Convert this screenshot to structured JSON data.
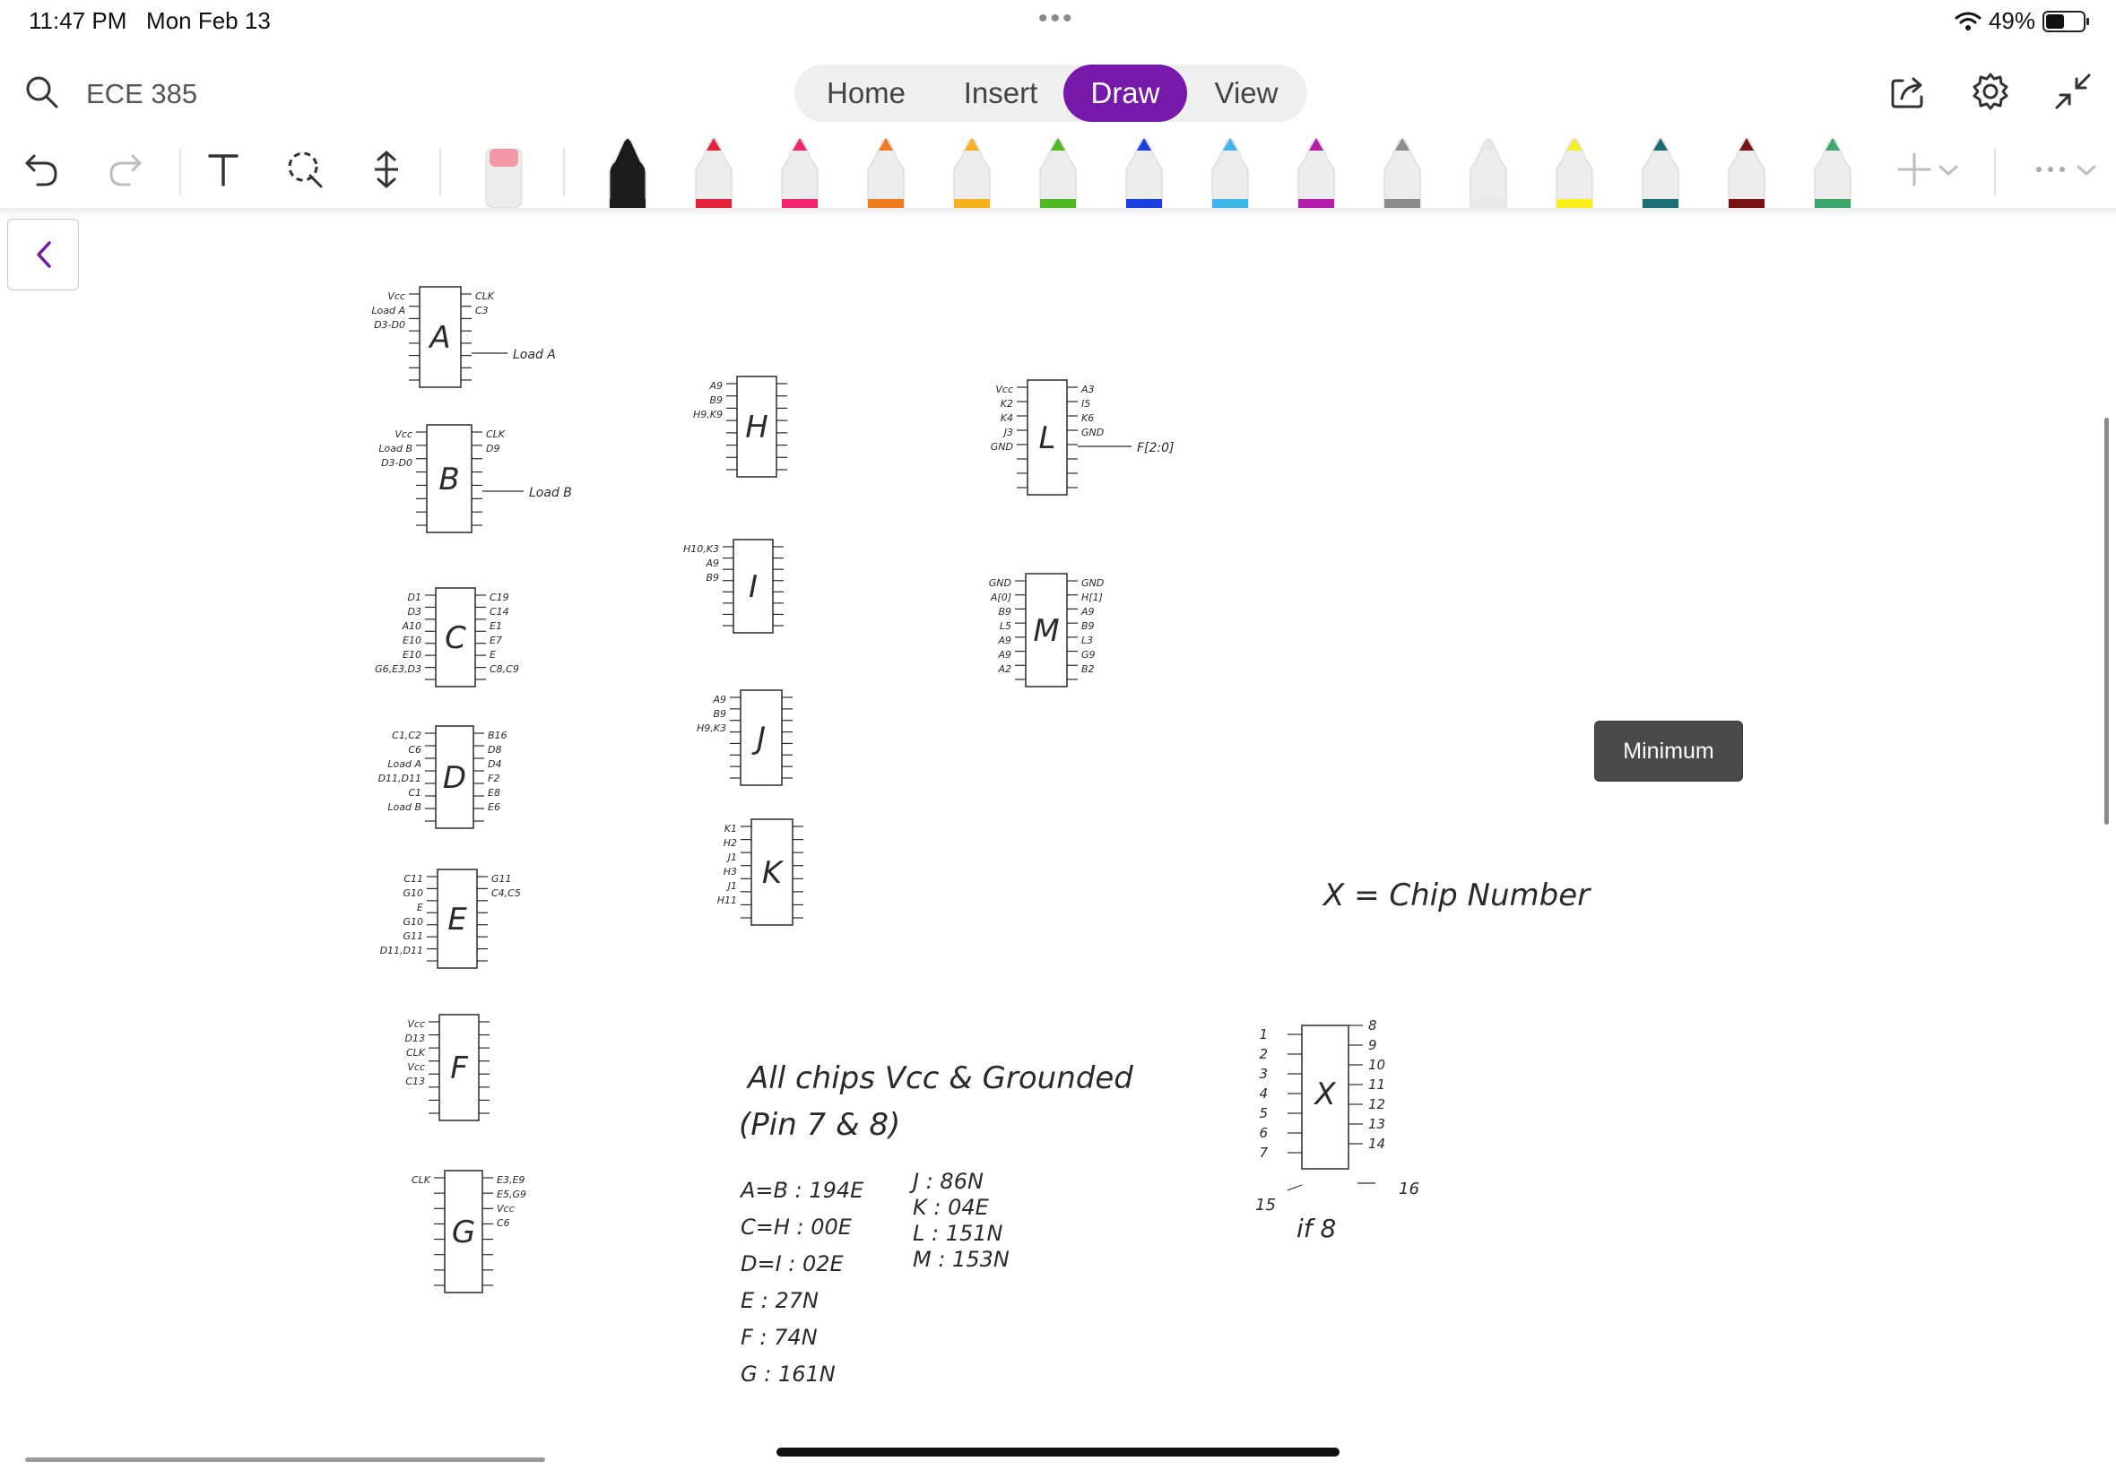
{
  "status_bar": {
    "time": "11:47 PM",
    "date": "Mon Feb 13",
    "dots": "•••",
    "battery": "49%",
    "battery_level": 0.49
  },
  "header": {
    "title": "ECE 385",
    "tabs": [
      {
        "label": "Home"
      },
      {
        "label": "Insert"
      },
      {
        "label": "Draw",
        "active": true
      },
      {
        "label": "View"
      }
    ],
    "accent": "#7719aa",
    "icons": [
      "search-icon",
      "share-icon",
      "settings-icon",
      "collapse-icon"
    ]
  },
  "toolbar": {
    "tools": [
      "undo-icon",
      "redo-icon",
      "text-icon",
      "lasso-icon",
      "add-space-icon",
      "eraser"
    ],
    "pens": [
      {
        "name": "black",
        "color": "#1c1c1c"
      },
      {
        "name": "red",
        "color": "#e2233a"
      },
      {
        "name": "pink",
        "color": "#f0256e"
      },
      {
        "name": "orange",
        "color": "#f07b1f"
      },
      {
        "name": "yellow-orange",
        "color": "#f5b21d"
      },
      {
        "name": "green",
        "color": "#4dbb1f"
      },
      {
        "name": "blue",
        "color": "#1a3fe0"
      },
      {
        "name": "light-blue",
        "color": "#3fb6ea"
      },
      {
        "name": "magenta",
        "color": "#b51ea8"
      },
      {
        "name": "gray",
        "color": "#8c8c8c"
      },
      {
        "name": "white",
        "color": "#e8e8e8"
      },
      {
        "name": "yellow-highlighter",
        "color": "#f8ef1c"
      },
      {
        "name": "teal-galaxy",
        "color": "#1b6f74"
      },
      {
        "name": "dark-red-galaxy",
        "color": "#7a1414"
      },
      {
        "name": "rainbow",
        "color": "#3aa76d"
      }
    ]
  },
  "tooltip": "Minimum",
  "notes": {
    "chip_labels": [
      "A",
      "B",
      "C",
      "D",
      "E",
      "F",
      "G",
      "H",
      "I",
      "J",
      "K",
      "L",
      "M"
    ],
    "pin_labels": {
      "A": {
        "left": [
          "Vcc",
          "Load A",
          "D3-D0"
        ],
        "right": [
          "CLK",
          "C3"
        ],
        "wire": "Load A"
      },
      "B": {
        "left": [
          "Vcc",
          "Load B",
          "D3-D0"
        ],
        "right": [
          "CLK",
          "D9"
        ],
        "wire": "Load B"
      },
      "C": {
        "left": [
          "D1",
          "D3",
          "A10",
          "E10",
          "E10",
          "G6,E3,D3"
        ],
        "right": [
          "C19",
          "C14",
          "E1",
          "E7",
          "E",
          "C8,C9"
        ]
      },
      "D": {
        "left": [
          "C1,C2",
          "C6",
          "Load A",
          "D11,D11",
          "C1",
          "Load B"
        ],
        "right": [
          "B16",
          "D8",
          "D4",
          "F2",
          "E8",
          "E6"
        ]
      },
      "E": {
        "left": [
          "C11",
          "G10",
          "E",
          "G10",
          "G11",
          "D11,D11"
        ],
        "right": [
          "G11",
          "C4,C5"
        ]
      },
      "F": {
        "left": [
          "Vcc",
          "D13",
          "CLK",
          "Vcc",
          "C13"
        ],
        "right": []
      },
      "G": {
        "left": [
          "CLK"
        ],
        "right": [
          "E3,E9",
          "E5,G9",
          "Vcc",
          "C6"
        ]
      },
      "H": {
        "left": [
          "A9",
          "B9",
          "H9,K9"
        ],
        "right": []
      },
      "I": {
        "left": [
          "H10,K3",
          "A9",
          "B9"
        ],
        "right": []
      },
      "J": {
        "left": [
          "A9",
          "B9",
          "H9,K3"
        ],
        "right": []
      },
      "K": {
        "left": [
          "K1",
          "H2",
          "J1",
          "H3",
          "J1",
          "H11"
        ],
        "right": []
      },
      "L": {
        "left": [
          "Vcc",
          "K2",
          "K4",
          "J3",
          "GND"
        ],
        "right": [
          "A3",
          "I5",
          "K6",
          "GND"
        ],
        "wire": "F[2:0]"
      },
      "M": {
        "left": [
          "GND",
          "A[0]",
          "B9",
          "L5",
          "A9",
          "A9",
          "A2"
        ],
        "right": [
          "GND",
          "H[1]",
          "A9",
          "B9",
          "L3",
          "G9",
          "B2"
        ]
      }
    },
    "legend_chip": {
      "label": "X",
      "left_pins": [
        "1",
        "2",
        "3",
        "4",
        "5",
        "6",
        "7"
      ],
      "right_pins": [
        "8",
        "9",
        "10",
        "11",
        "12",
        "13",
        "14"
      ],
      "bottom_left": "15",
      "bottom_right": "16",
      "caption": "if 8"
    },
    "chip_number_note": "X = Chip Number",
    "all_chips_note_line1": "All chips Vcc & Grounded",
    "all_chips_note_line2": "(Pin 7 & 8)",
    "part_list_left": [
      "A=B : 194E",
      "C=H : 00E",
      "D=I : 02E",
      "E : 27N",
      "F : 74N",
      "G : 161N"
    ],
    "part_list_right": [
      "J : 86N",
      "K : 04E",
      "L : 151N",
      "M : 153N"
    ]
  }
}
